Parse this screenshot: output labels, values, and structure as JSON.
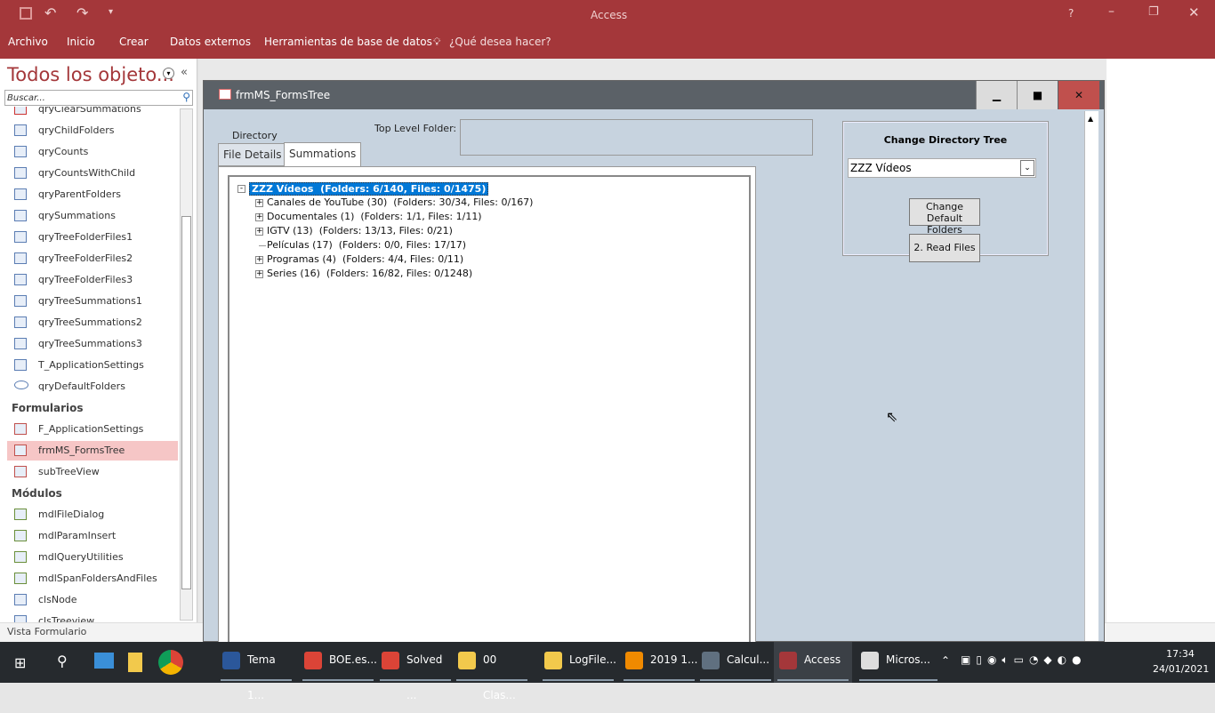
{
  "app": {
    "title": "Access",
    "colors": {
      "brand": "#a4373a",
      "selection": "#0078d7"
    }
  },
  "titlebar": {
    "help": "?",
    "icons": [
      "save-icon",
      "undo-icon",
      "redo-icon",
      "customize-icon",
      "minimize-icon",
      "restore-icon",
      "close-icon"
    ]
  },
  "ribbon": {
    "tabs": [
      "Archivo",
      "Inicio",
      "Crear",
      "Datos externos",
      "Herramientas de base de datos"
    ],
    "tell_me": "¿Qué desea hacer?"
  },
  "nav": {
    "title": "Todos los objeto...",
    "search_placeholder": "Buscar...",
    "items": [
      {
        "label": "qryClearSummations",
        "type": "query-delete"
      },
      {
        "label": "qryChildFolders",
        "type": "query"
      },
      {
        "label": "qryCounts",
        "type": "query"
      },
      {
        "label": "qryCountsWithChild",
        "type": "query"
      },
      {
        "label": "qryParentFolders",
        "type": "query"
      },
      {
        "label": "qrySummations",
        "type": "query"
      },
      {
        "label": "qryTreeFolderFiles1",
        "type": "query"
      },
      {
        "label": "qryTreeFolderFiles2",
        "type": "query"
      },
      {
        "label": "qryTreeFolderFiles3",
        "type": "query"
      },
      {
        "label": "qryTreeSummations1",
        "type": "query"
      },
      {
        "label": "qryTreeSummations2",
        "type": "query"
      },
      {
        "label": "qryTreeSummations3",
        "type": "query"
      },
      {
        "label": "T_ApplicationSettings",
        "type": "query"
      },
      {
        "label": "qryDefaultFolders",
        "type": "union"
      },
      {
        "group": "Formularios"
      },
      {
        "label": "F_ApplicationSettings",
        "type": "form"
      },
      {
        "label": "frmMS_FormsTree",
        "type": "form",
        "selected": true
      },
      {
        "label": "subTreeView",
        "type": "form"
      },
      {
        "group": "Módulos"
      },
      {
        "label": "mdlFileDialog",
        "type": "module"
      },
      {
        "label": "mdlParamInsert",
        "type": "module"
      },
      {
        "label": "mdlQueryUtilities",
        "type": "module"
      },
      {
        "label": "mdlSpanFoldersAndFiles",
        "type": "module"
      },
      {
        "label": "clsNode",
        "type": "class"
      },
      {
        "label": "clsTreeview",
        "type": "class"
      }
    ]
  },
  "status": "Vista Formulario",
  "form": {
    "title": "frmMS_FormsTree",
    "directory_label": "Directory",
    "top_level_label": "Top Level Folder:",
    "top_level_value": "",
    "tabs": [
      "File Details",
      "Summations"
    ],
    "active_tab": 1,
    "tree": {
      "root": "ZZZ Vídeos  (Folders: 6/140, Files: 0/1475)",
      "children": [
        {
          "label": "Canales de YouTube (30)  (Folders: 30/34, Files: 0/167)",
          "expandable": true
        },
        {
          "label": "Documentales (1)  (Folders: 1/1, Files: 1/11)",
          "expandable": true
        },
        {
          "label": "IGTV (13)  (Folders: 13/13, Files: 0/21)",
          "expandable": true
        },
        {
          "label": "Películas (17)  (Folders: 0/0, Files: 17/17)",
          "expandable": false
        },
        {
          "label": "Programas (4)  (Folders: 4/4, Files: 0/11)",
          "expandable": true
        },
        {
          "label": "Series (16)  (Folders: 16/82, Files: 0/1248)",
          "expandable": true
        }
      ]
    },
    "panel": {
      "title": "Change Directory Tree",
      "combo_value": "ZZZ Vídeos",
      "btn_change_l1": "Change",
      "btn_change_l2": "Default Folders",
      "btn_read": "2. Read Files"
    }
  },
  "taskbar": {
    "items": [
      {
        "label": "Tema 1...",
        "color": "#2b579a"
      },
      {
        "label": "BOE.es...",
        "color": "#db4437"
      },
      {
        "label": "Solved ...",
        "color": "#db4437"
      },
      {
        "label": "00 Clas...",
        "color": "#f2c94c"
      },
      {
        "label": "LogFile...",
        "color": "#f2c94c"
      },
      {
        "label": "2019 1...",
        "color": "#f08a00"
      },
      {
        "label": "Calcul...",
        "color": "#607080"
      },
      {
        "label": "Access",
        "color": "#a4373a"
      },
      {
        "label": "Micros...",
        "color": "#dddddd"
      }
    ],
    "time": "17:34",
    "date": "24/01/2021"
  }
}
